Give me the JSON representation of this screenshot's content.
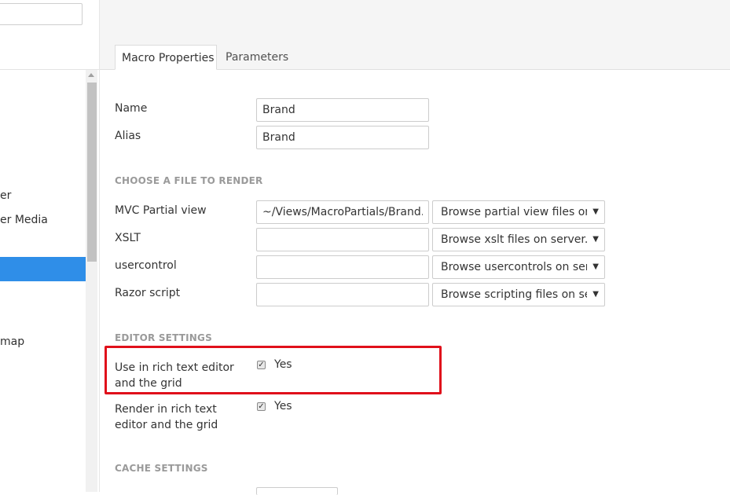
{
  "sidebar": {
    "items": [
      {
        "label": "er",
        "active": false
      },
      {
        "label": "er Media",
        "active": false
      },
      {
        "label": "",
        "active": true
      },
      {
        "label": "map",
        "active": false
      }
    ]
  },
  "tabs": [
    {
      "label": "Macro Properties",
      "active": true
    },
    {
      "label": "Parameters",
      "active": false
    }
  ],
  "form": {
    "name": {
      "label": "Name",
      "value": "Brand"
    },
    "alias": {
      "label": "Alias",
      "value": "Brand"
    },
    "choose_file_heading": "CHOOSE A FILE TO RENDER",
    "files": [
      {
        "label": "MVC Partial view",
        "value": "~/Views/MacroPartials/Brand.cs",
        "browse": "Browse partial view files on s"
      },
      {
        "label": "XSLT",
        "value": "",
        "browse": "Browse xslt files on server..."
      },
      {
        "label": "usercontrol",
        "value": "",
        "browse": "Browse usercontrols on serv"
      },
      {
        "label": "Razor script",
        "value": "",
        "browse": "Browse scripting files on ser"
      }
    ],
    "editor_heading": "EDITOR SETTINGS",
    "editor": [
      {
        "label_line1": "Use in rich text editor",
        "label_line2": "and the grid",
        "checked": true,
        "value_label": "Yes"
      },
      {
        "label_line1": "Render in rich text",
        "label_line2": "editor and the grid",
        "checked": true,
        "value_label": "Yes"
      }
    ],
    "cache_heading": "CACHE SETTINGS"
  },
  "colors": {
    "accent": "#2f8ee8",
    "highlight": "#e0101b"
  }
}
